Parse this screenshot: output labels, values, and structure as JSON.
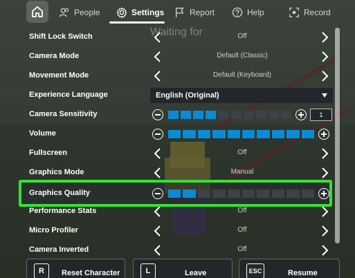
{
  "nav": {
    "tabs": [
      {
        "label": "People",
        "icon": "people-icon"
      },
      {
        "label": "Settings",
        "icon": "gear-icon"
      },
      {
        "label": "Report",
        "icon": "flag-icon"
      },
      {
        "label": "Help",
        "icon": "help-icon"
      },
      {
        "label": "Record",
        "icon": "record-icon"
      }
    ],
    "active": "Settings"
  },
  "background_text": "Waiting for",
  "settings": {
    "shift_lock": {
      "label": "Shift Lock Switch",
      "value": "Off"
    },
    "camera_mode": {
      "label": "Camera Mode",
      "value": "Default (Classic)"
    },
    "movement_mode": {
      "label": "Movement Mode",
      "value": "Default (Keyboard)"
    },
    "experience_language": {
      "label": "Experience Language",
      "value": "English (Original)"
    },
    "camera_sensitivity": {
      "label": "Camera Sensitivity",
      "value": "1",
      "level_fraction": 0.4
    },
    "volume": {
      "label": "Volume",
      "level_fraction": 1.0
    },
    "fullscreen": {
      "label": "Fullscreen",
      "value": "Off"
    },
    "graphics_mode": {
      "label": "Graphics Mode",
      "value": "Manual"
    },
    "graphics_quality": {
      "label": "Graphics Quality",
      "level_fraction": 0.2
    },
    "performance_stats": {
      "label": "Performance Stats",
      "value": "Off"
    },
    "micro_profiler": {
      "label": "Micro Profiler",
      "value": "Off"
    },
    "camera_inverted": {
      "label": "Camera Inverted",
      "value": "Off"
    }
  },
  "bottom": {
    "reset": {
      "key": "R",
      "label": "Reset Character"
    },
    "leave": {
      "key": "L",
      "label": "Leave"
    },
    "resume": {
      "key": "ESC",
      "label": "Resume"
    }
  },
  "colors": {
    "accent": "#0a8bd6",
    "highlight": "#35e235"
  }
}
